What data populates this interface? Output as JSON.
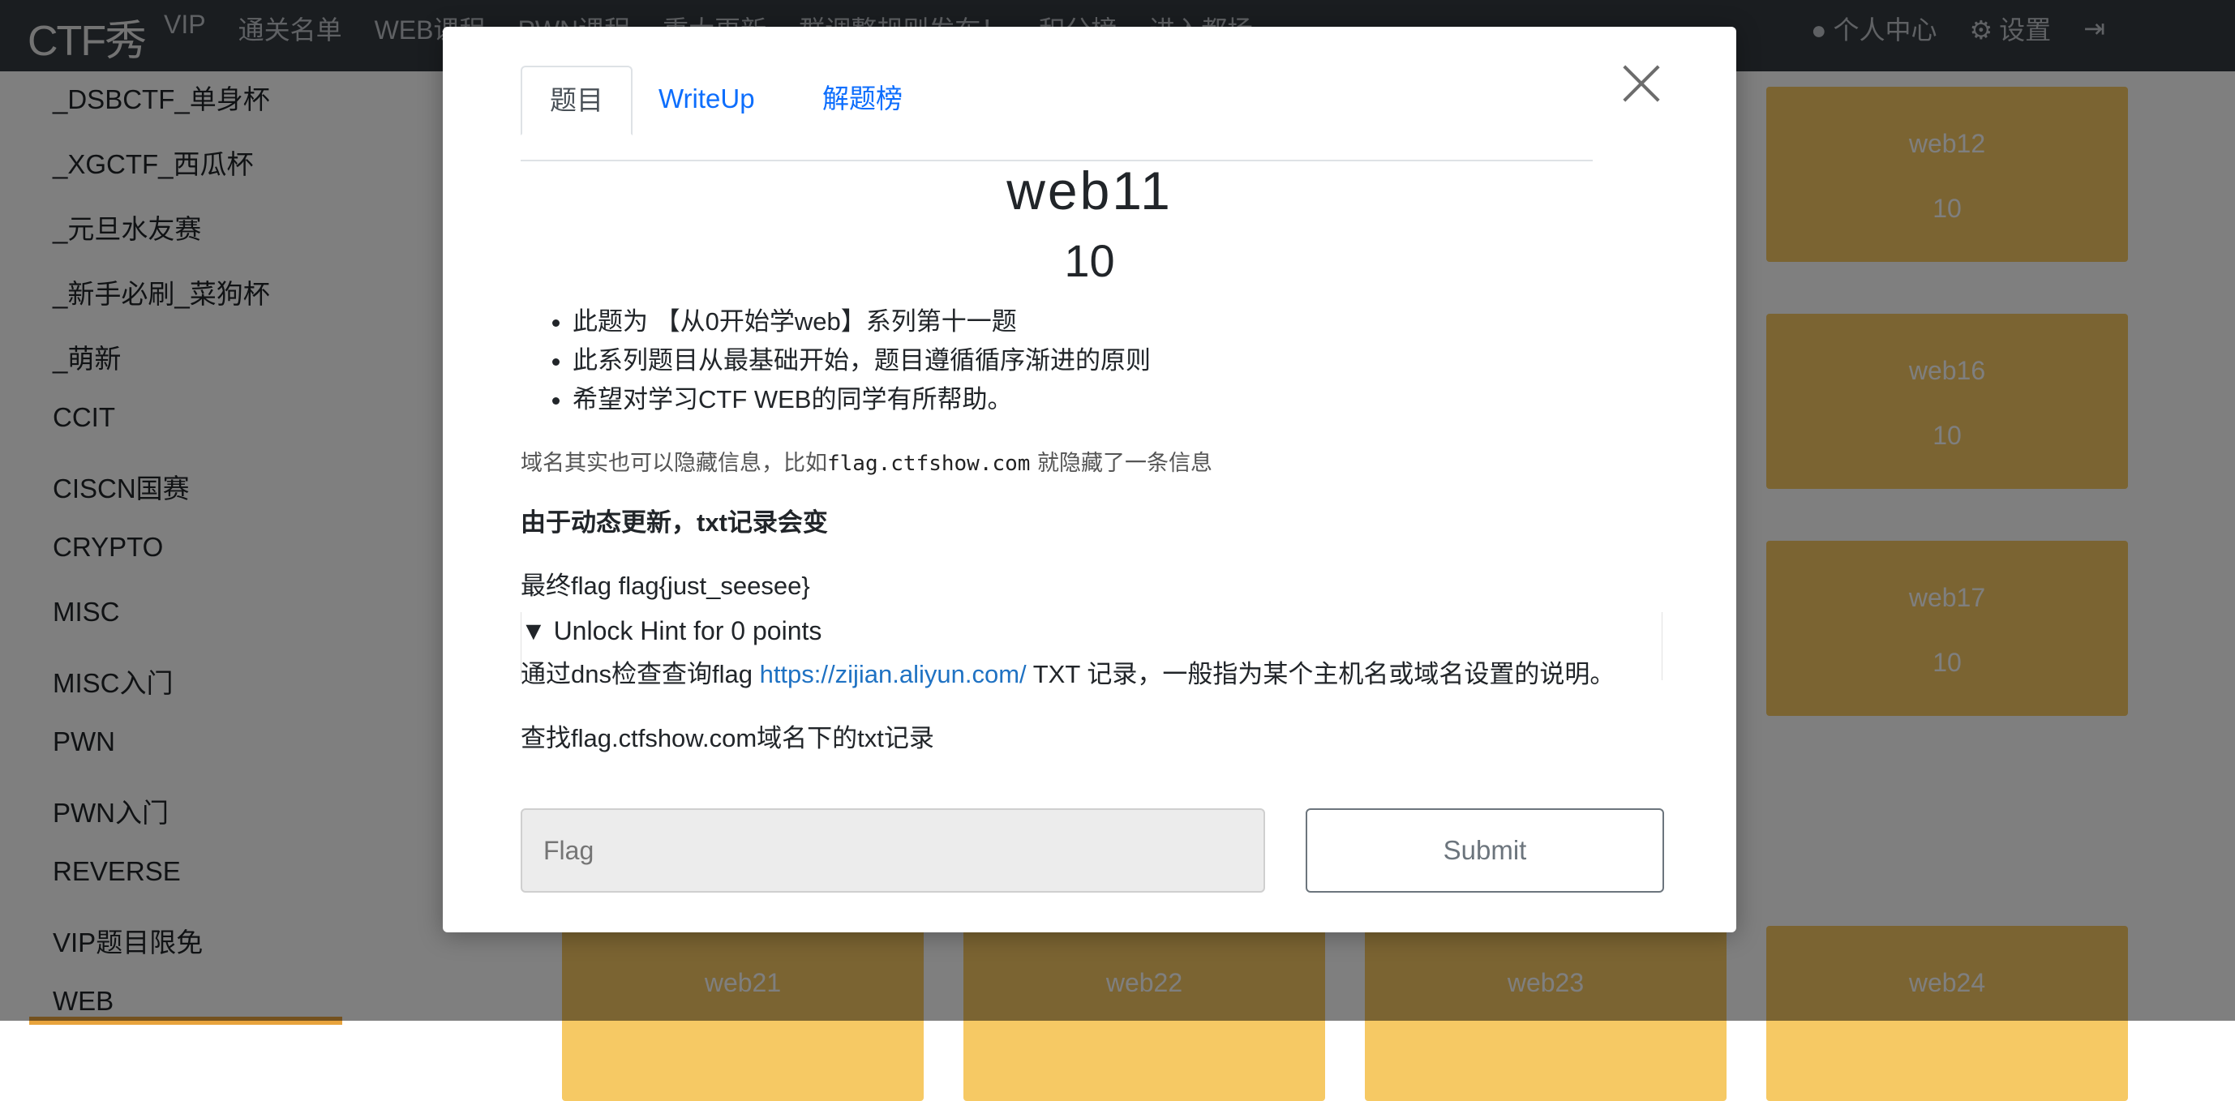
{
  "navbar": {
    "brand": "CTF秀",
    "links": [
      "VIP",
      "通关名单",
      "WEB课程",
      "PWN课程",
      "重大更新",
      "群调整规则发布！",
      "积分榜",
      "进入都场"
    ],
    "right": [
      "个人中心",
      "设置"
    ]
  },
  "sidebar": {
    "items": [
      "_DSBCTF_单身杯",
      "_XGCTF_西瓜杯",
      "_元旦水友赛",
      "_新手必刷_菜狗杯",
      "_萌新",
      "CCIT",
      "CISCN国赛",
      "CRYPTO",
      "MISC",
      "MISC入门",
      "PWN",
      "PWN入门",
      "REVERSE",
      "VIP题目限免",
      "WEB"
    ]
  },
  "cards": [
    {
      "name": "web12",
      "points": "10"
    },
    {
      "name": "web16",
      "points": "10"
    },
    {
      "name": "web17",
      "points": "10"
    },
    {
      "name": "web21",
      "points": ""
    },
    {
      "name": "web22",
      "points": ""
    },
    {
      "name": "web23",
      "points": ""
    },
    {
      "name": "web24",
      "points": ""
    }
  ],
  "modal": {
    "tabs": [
      "题目",
      "WriteUp",
      "解题榜"
    ],
    "title": "web11",
    "score": "10",
    "description": [
      "此题为 【从0开始学web】系列第十一题",
      "此系列题目从最基础开始，题目遵循循序渐进的原则",
      "希望对学习CTF WEB的同学有所帮助。"
    ],
    "note_prefix": "域名其实也可以隐藏信息，比如",
    "note_code": "flag.ctfshow.com",
    "note_suffix": " 就隐藏了一条信息",
    "bold_line": "由于动态更新，txt记录会变",
    "final_line": "最终flag flag{just_seesee}",
    "hint_summary": "▼ Unlock Hint for 0 points",
    "hint_prefix": "通过dns检查查询flag ",
    "hint_link": "https://zijian.aliyun.com/",
    "hint_suffix": " TXT 记录，一般指为某个主机名或域名设置的说明。",
    "search_line": "查找flag.ctfshow.com域名下的txt记录",
    "flag_placeholder": "Flag",
    "submit_label": "Submit"
  }
}
